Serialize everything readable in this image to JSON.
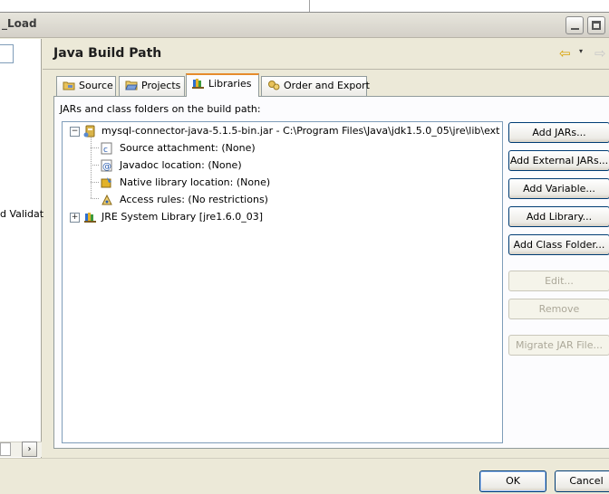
{
  "window": {
    "title": "_Load"
  },
  "left_pane": {
    "partial_text": "d Validat",
    "scroll_right_glyph": "›"
  },
  "page": {
    "title": "Java Build Path",
    "back_icon": "yellow-left-arrow",
    "menu_icon": "▾",
    "forward_icon": "grey-right-arrow"
  },
  "tabs": [
    {
      "label": "Source",
      "icon": "source-folder-icon"
    },
    {
      "label": "Projects",
      "icon": "projects-folder-icon"
    },
    {
      "label": "Libraries",
      "icon": "library-books-icon",
      "active": true
    },
    {
      "label": "Order and Export",
      "icon": "order-export-icon"
    }
  ],
  "libraries": {
    "caption": "JARs and class folders on the build path:",
    "tree": [
      {
        "label": "mysql-connector-java-5.1.5-bin.jar - C:\\Program Files\\Java\\jdk1.5.0_05\\jre\\lib\\ext",
        "icon": "jar-icon",
        "expanded": true,
        "children": [
          {
            "label": "Source attachment: (None)",
            "icon": "source-attachment-icon"
          },
          {
            "label": "Javadoc location: (None)",
            "icon": "javadoc-icon"
          },
          {
            "label": "Native library location: (None)",
            "icon": "native-library-icon"
          },
          {
            "label": "Access rules: (No restrictions)",
            "icon": "access-rules-icon"
          }
        ]
      },
      {
        "label": "JRE System Library [jre1.6.0_03]",
        "icon": "library-books-icon",
        "expanded": false
      }
    ],
    "buttons": [
      {
        "label": "Add JARs...",
        "enabled": true
      },
      {
        "label": "Add External JARs...",
        "enabled": true
      },
      {
        "label": "Add Variable...",
        "enabled": true
      },
      {
        "label": "Add Library...",
        "enabled": true
      },
      {
        "label": "Add Class Folder...",
        "enabled": true
      },
      {
        "label": "Edit...",
        "enabled": false
      },
      {
        "label": "Remove",
        "enabled": false
      },
      {
        "label": "Migrate JAR File...",
        "enabled": false
      }
    ]
  },
  "dialog": {
    "ok_label": "OK",
    "cancel_label": "Cancel"
  },
  "colors": {
    "active_tab_accent": "#e68b2c",
    "button_border": "#003c74",
    "list_border": "#7f9db9",
    "dialog_bg": "#ece9d8"
  }
}
